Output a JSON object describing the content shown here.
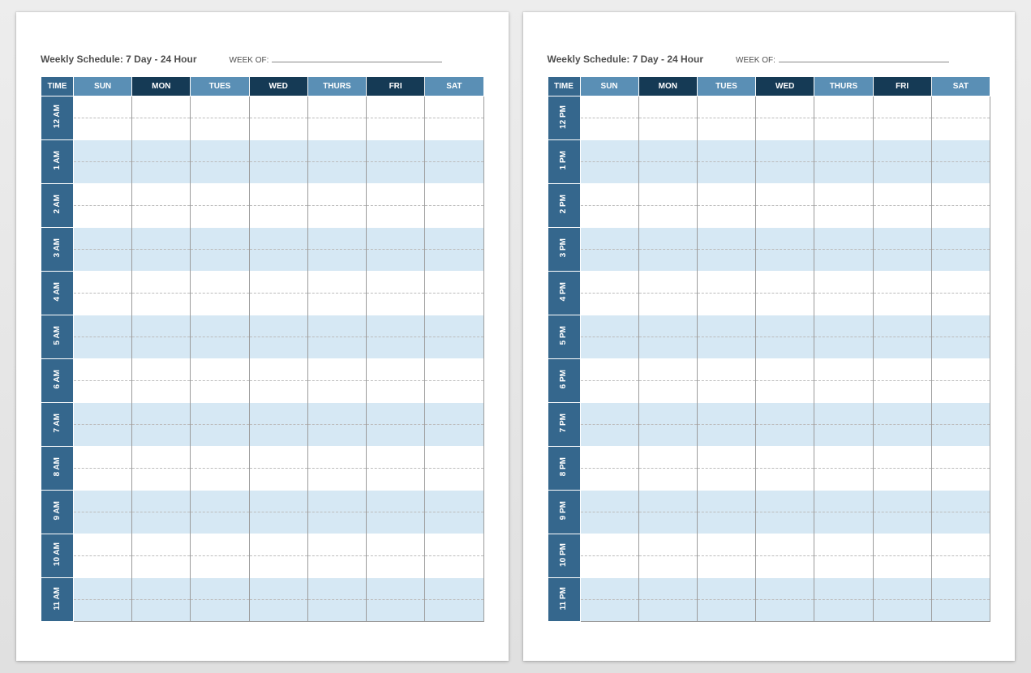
{
  "title": "Weekly Schedule: 7 Day - 24 Hour",
  "week_of_label": "WEEK OF:",
  "headers": {
    "time": "TIME",
    "days": [
      {
        "label": "SUN",
        "dark": false
      },
      {
        "label": "MON",
        "dark": true
      },
      {
        "label": "TUES",
        "dark": false
      },
      {
        "label": "WED",
        "dark": true
      },
      {
        "label": "THURS",
        "dark": false
      },
      {
        "label": "FRI",
        "dark": true
      },
      {
        "label": "SAT",
        "dark": false
      }
    ]
  },
  "pages": [
    {
      "hours": [
        "12 AM",
        "1 AM",
        "2 AM",
        "3 AM",
        "4 AM",
        "5 AM",
        "6 AM",
        "7 AM",
        "8 AM",
        "9 AM",
        "10 AM",
        "11 AM"
      ]
    },
    {
      "hours": [
        "12 PM",
        "1 PM",
        "2 PM",
        "3 PM",
        "4 PM",
        "5 PM",
        "6 PM",
        "7 PM",
        "8 PM",
        "9 PM",
        "10 PM",
        "11 PM"
      ]
    }
  ]
}
